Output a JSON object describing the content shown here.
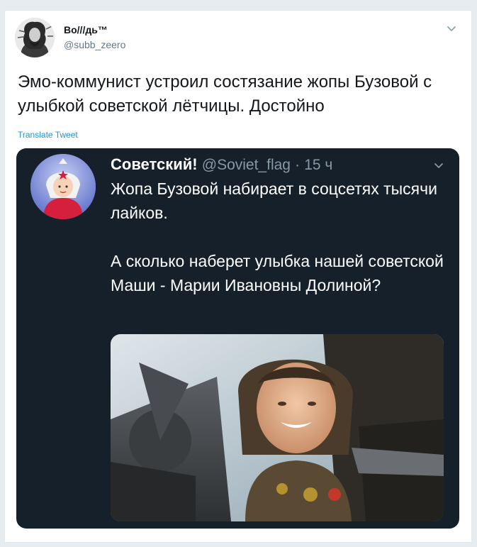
{
  "tweet": {
    "author_name": "Во///дь™",
    "author_handle": "@subb_zeero",
    "text": "Эмо-коммунист устроил состязание жопы Бузовой с улыбкой советской лётчицы. Достойно",
    "translate_label": "Translate Tweet",
    "caret_icon": "chevron-down-icon"
  },
  "embedded": {
    "name": "Советский!",
    "handle": "@Soviet_flag",
    "separator": "·",
    "time": "15 ч",
    "paragraphs": [
      "Жопа Бузовой набирает в соцсетях тысячи лайков.",
      "А сколько наберет улыбка нашей советской Маши - Марии Ивановны Долиной?"
    ],
    "background_color": "#15202b",
    "caret_icon": "chevron-down-icon"
  },
  "colors": {
    "link": "#1b95e0",
    "secondary_text": "#657786"
  }
}
